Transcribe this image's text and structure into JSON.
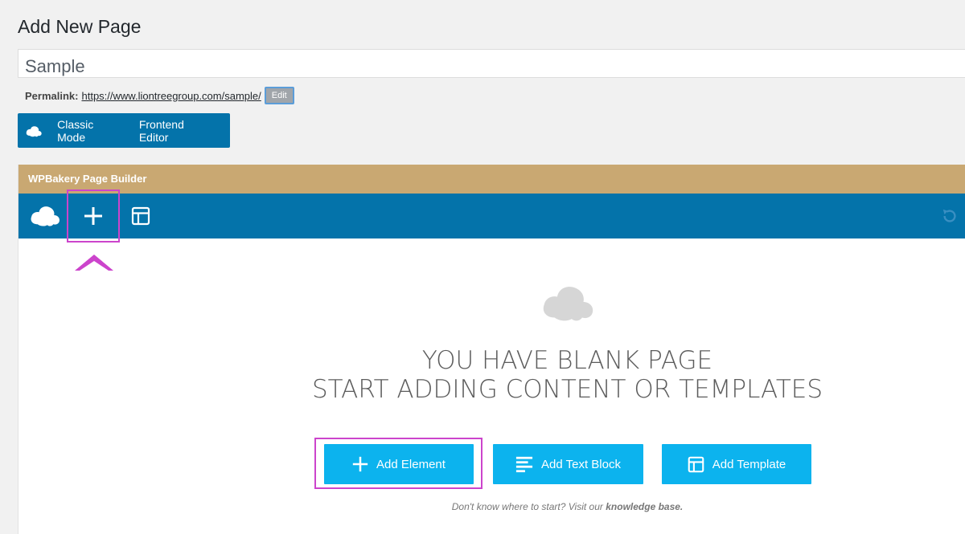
{
  "page": {
    "title": "Add New Page"
  },
  "title_field": {
    "value": "Sample"
  },
  "permalink": {
    "label": "Permalink:",
    "url": "https://www.liontreegroup.com/sample/",
    "edit_label": "Edit"
  },
  "mode_bar": {
    "classic_label": "Classic Mode",
    "frontend_label": "Frontend Editor"
  },
  "builder": {
    "header_title": "WPBakery Page Builder",
    "blank_line1": "YOU HAVE BLANK PAGE",
    "blank_line2": "START ADDING CONTENT OR TEMPLATES",
    "add_element_label": "Add Element",
    "add_text_block_label": "Add Text Block",
    "add_template_label": "Add Template",
    "help_prefix": "Don't know where to start? Visit our",
    "help_link": "knowledge base."
  },
  "icons": {
    "builder_logo": "cloud-logo-icon",
    "add": "plus-icon",
    "template": "layout-template-icon",
    "undo": "undo-icon",
    "text_block": "align-left-icon",
    "annotation": "up-arrow-icon"
  },
  "colors": {
    "brand_blue": "#0473aa",
    "button_blue": "#0cb3ee",
    "header_gold": "#c9a872",
    "highlight": "#cc44cc"
  }
}
